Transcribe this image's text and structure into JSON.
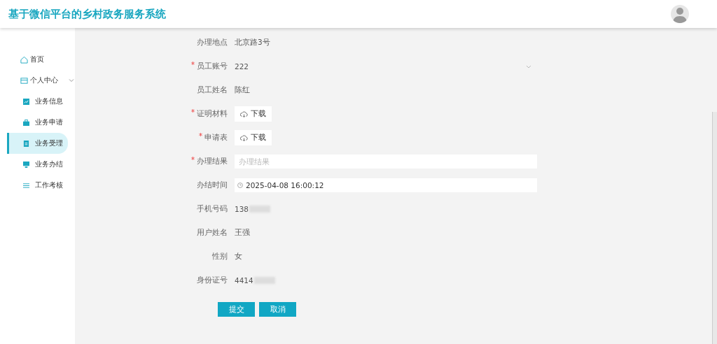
{
  "header": {
    "title": "基于微信平台的乡村政务服务系统"
  },
  "sidebar": {
    "items": [
      {
        "label": "首页",
        "selected": false
      },
      {
        "label": "个人中心",
        "selected": false,
        "expanded": true,
        "children": [
          {
            "label": "业务信息",
            "selected": false
          },
          {
            "label": "业务申请",
            "selected": false
          },
          {
            "label": "业务受理",
            "selected": true
          },
          {
            "label": "业务办结",
            "selected": false
          },
          {
            "label": "工作考核",
            "selected": false
          }
        ]
      }
    ]
  },
  "form": {
    "fields": [
      {
        "label": "办理地点",
        "required": false,
        "kind": "text",
        "value": "北京路3号"
      },
      {
        "label": "员工账号",
        "required": true,
        "kind": "select",
        "value": "222"
      },
      {
        "label": "员工姓名",
        "required": false,
        "kind": "text",
        "value": "陈红"
      },
      {
        "label": "证明材料",
        "required": true,
        "kind": "download",
        "value": "下载"
      },
      {
        "label": "申请表",
        "required": true,
        "kind": "download",
        "value": "下载"
      },
      {
        "label": "办理结果",
        "required": true,
        "kind": "input",
        "placeholder": "办理结果"
      },
      {
        "label": "办结时间",
        "required": false,
        "kind": "datetime",
        "value": "2025-04-08 16:00:12"
      },
      {
        "label": "手机号码",
        "required": false,
        "kind": "redacted",
        "value": "138"
      },
      {
        "label": "用户姓名",
        "required": false,
        "kind": "text",
        "value": "王强"
      },
      {
        "label": "性别",
        "required": false,
        "kind": "text",
        "value": "女"
      },
      {
        "label": "身份证号",
        "required": false,
        "kind": "redacted",
        "value": "4414"
      }
    ],
    "buttons": [
      "提交",
      "取消"
    ]
  }
}
